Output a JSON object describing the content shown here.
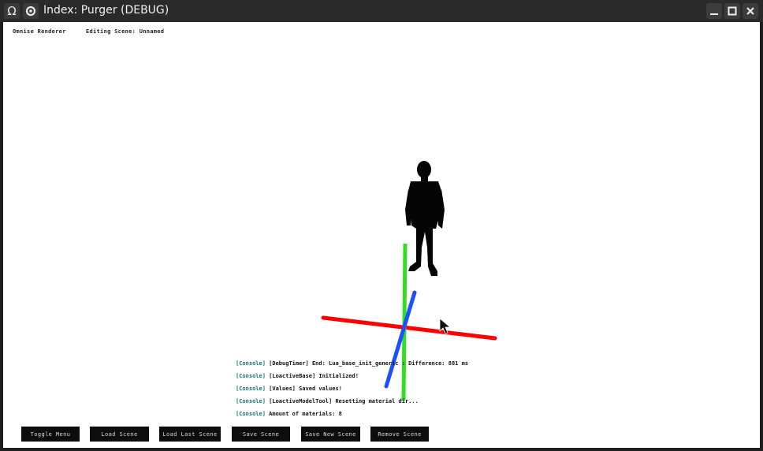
{
  "window": {
    "title": "Index: Purger (DEBUG)",
    "app_icon": "omega-icon",
    "secondary_icon": "gear-icon",
    "controls": [
      "minimize-icon",
      "maximize-icon",
      "close-icon"
    ]
  },
  "hud": {
    "renderer": "Omnise Renderer",
    "scene": "Editing Scene: Unnamed"
  },
  "console": [
    {
      "tag": "[Console]",
      "text": " [DebugTimer] End: Lua_base_init_generic : Difference: 881 ms"
    },
    {
      "tag": "[Console]",
      "text": " [LoactiveBase] Initialized!"
    },
    {
      "tag": "[Console]",
      "text": " [Values] Saved values!"
    },
    {
      "tag": "[Console]",
      "text": " [LoactiveModelTool] Resetting material dir..."
    },
    {
      "tag": "[Console]",
      "text": " Amount of materials: 8"
    }
  ],
  "buttons": {
    "toggle_menu": "Toggle Menu",
    "load_scene": "Load Scene",
    "load_last_scene": "Load Last Scene",
    "save_scene": "Save Scene",
    "save_new_scene": "Save New Scene",
    "remove_scene": "Remove Scene"
  },
  "colors": {
    "axis_x": "#ff0000",
    "axis_y": "#33dd22",
    "axis_z": "#1f4fff",
    "console_tag": "#1f6f80"
  }
}
